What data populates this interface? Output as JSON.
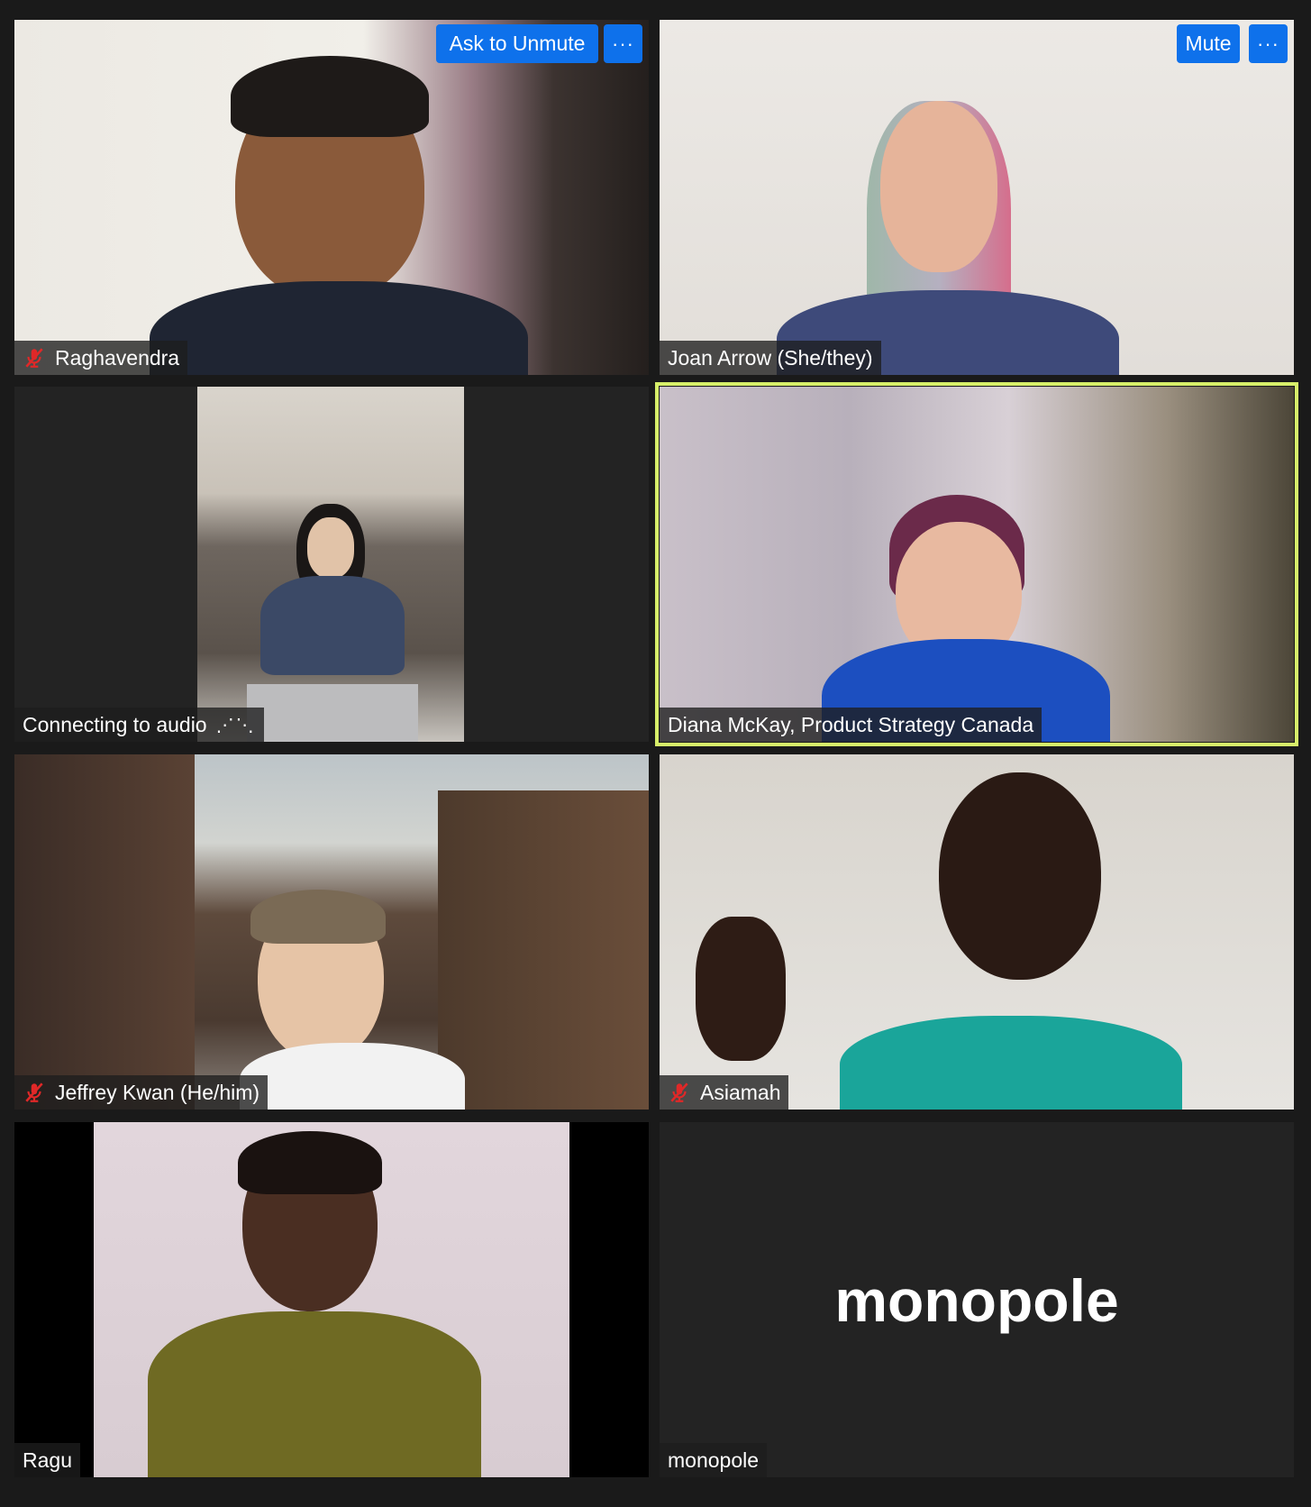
{
  "participants": [
    {
      "name": "Raghavendra",
      "muted": true
    },
    {
      "name": "Joan Arrow (She/they)",
      "muted": false
    },
    {
      "name": "Connecting to audio",
      "muted": false,
      "status_indicator": "⋰⋱"
    },
    {
      "name": "Diana McKay, Product Strategy Canada",
      "muted": false,
      "active_speaker": true
    },
    {
      "name": "Jeffrey Kwan (He/him)",
      "muted": true
    },
    {
      "name": "Asiamah",
      "muted": true
    },
    {
      "name": "Ragu",
      "muted": false
    },
    {
      "name": "monopole",
      "muted": false,
      "video_off": true,
      "display_name": "monopole"
    }
  ],
  "controls": {
    "ask_to_unmute": "Ask to Unmute",
    "mute": "Mute",
    "more": "···"
  },
  "colors": {
    "accent_blue": "#0e71eb",
    "active_speaker_border": "#d7ef6a",
    "mute_red": "#e02828",
    "tile_bg": "#232323"
  }
}
